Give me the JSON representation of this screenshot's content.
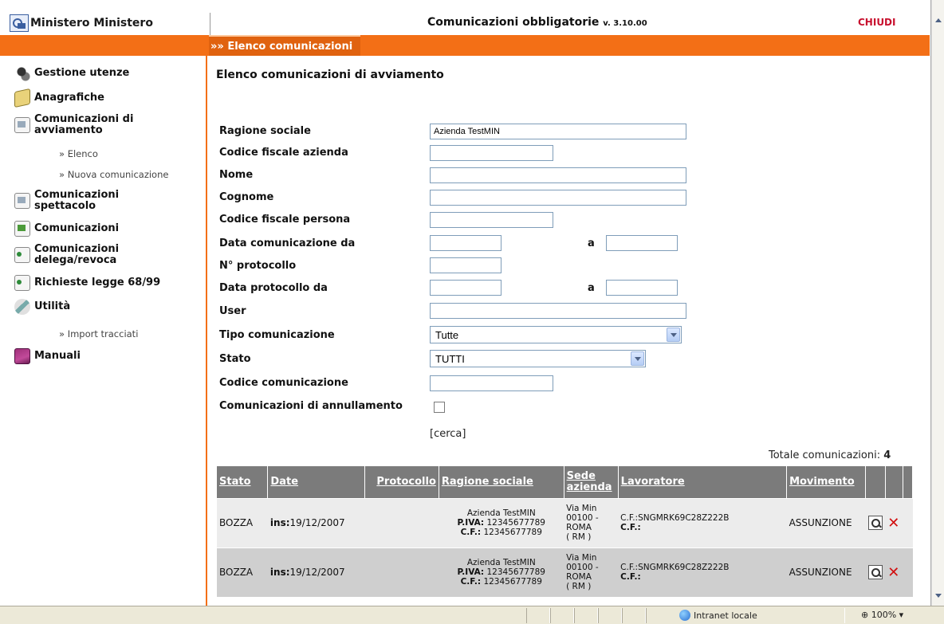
{
  "header": {
    "brand": "Ministero Ministero",
    "app_title": "Comunicazioni obbligatorie",
    "version": "v. 3.10.00",
    "close_label": "CHIUDI"
  },
  "breadcrumb": "»» Elenco comunicazioni",
  "sidebar": {
    "items": [
      {
        "label": "Gestione utenze",
        "icon": "users-icon"
      },
      {
        "label": "Anagrafiche",
        "icon": "book-icon"
      },
      {
        "label": "Comunicazioni di avviamento",
        "icon": "document-icon"
      },
      {
        "label": "Comunicazioni spettacolo",
        "icon": "document-icon"
      },
      {
        "label": "Comunicazioni",
        "icon": "document-icon"
      },
      {
        "label": "Comunicazioni delega/revoca",
        "icon": "document-icon"
      },
      {
        "label": "Richieste legge 68/99",
        "icon": "document-icon"
      },
      {
        "label": "Utilità",
        "icon": "tools-icon"
      },
      {
        "label": "Manuali",
        "icon": "manuals-icon"
      }
    ],
    "sub_avviamento": [
      "» Elenco",
      "» Nuova comunicazione"
    ],
    "sub_utilita": [
      "» Import tracciati"
    ]
  },
  "page": {
    "title": "Elenco comunicazioni di avviamento"
  },
  "form": {
    "ragione_sociale": {
      "label": "Ragione sociale",
      "value": "Azienda TestMIN"
    },
    "cf_azienda": {
      "label": "Codice fiscale azienda",
      "value": ""
    },
    "nome": {
      "label": "Nome",
      "value": ""
    },
    "cognome": {
      "label": "Cognome",
      "value": ""
    },
    "cf_persona": {
      "label": "Codice fiscale persona",
      "value": ""
    },
    "data_com": {
      "label": "Data comunicazione da",
      "to_label": "a"
    },
    "protocollo": {
      "label": "N° protocollo",
      "value": ""
    },
    "data_prot": {
      "label": "Data protocollo da",
      "to_label": "a"
    },
    "user": {
      "label": "User",
      "value": ""
    },
    "tipo": {
      "label": "Tipo comunicazione",
      "value": "Tutte"
    },
    "stato": {
      "label": "Stato",
      "value": "TUTTI"
    },
    "codice": {
      "label": "Codice comunicazione",
      "value": ""
    },
    "annullamento": {
      "label": "Comunicazioni di annullamento",
      "checked": false
    },
    "search_label": "[cerca]"
  },
  "results": {
    "total_label": "Totale comunicazioni:",
    "total": "4",
    "columns": [
      "Stato",
      "Date",
      "Protocollo",
      "Ragione sociale",
      "Sede azienda",
      "Lavoratore",
      "Movimento"
    ],
    "rows": [
      {
        "stato": "BOZZA",
        "date_prefix": "ins:",
        "date": "19/12/2007",
        "protocollo": "",
        "ragione": "Azienda TestMIN",
        "piva_label": "P.IVA:",
        "piva": "12345677789",
        "cf_label": "C.F.:",
        "cf": "12345677789",
        "sede": [
          "Via Min",
          "00100 -",
          "ROMA",
          "( RM )"
        ],
        "lav_cf": "C.F.:SNGMRK69C28Z222B",
        "lav_cf2": "C.F.:",
        "movimento": "ASSUNZIONE"
      },
      {
        "stato": "BOZZA",
        "date_prefix": "ins:",
        "date": "19/12/2007",
        "protocollo": "",
        "ragione": "Azienda TestMIN",
        "piva_label": "P.IVA:",
        "piva": "12345677789",
        "cf_label": "C.F.:",
        "cf": "12345677789",
        "sede": [
          "Via Min",
          "00100 -",
          "ROMA",
          "( RM )"
        ],
        "lav_cf": "C.F.:SNGMRK69C28Z222B",
        "lav_cf2": "C.F.:",
        "movimento": "ASSUNZIONE"
      }
    ]
  },
  "statusbar": {
    "zone": "Intranet locale",
    "zoom": "100%"
  }
}
